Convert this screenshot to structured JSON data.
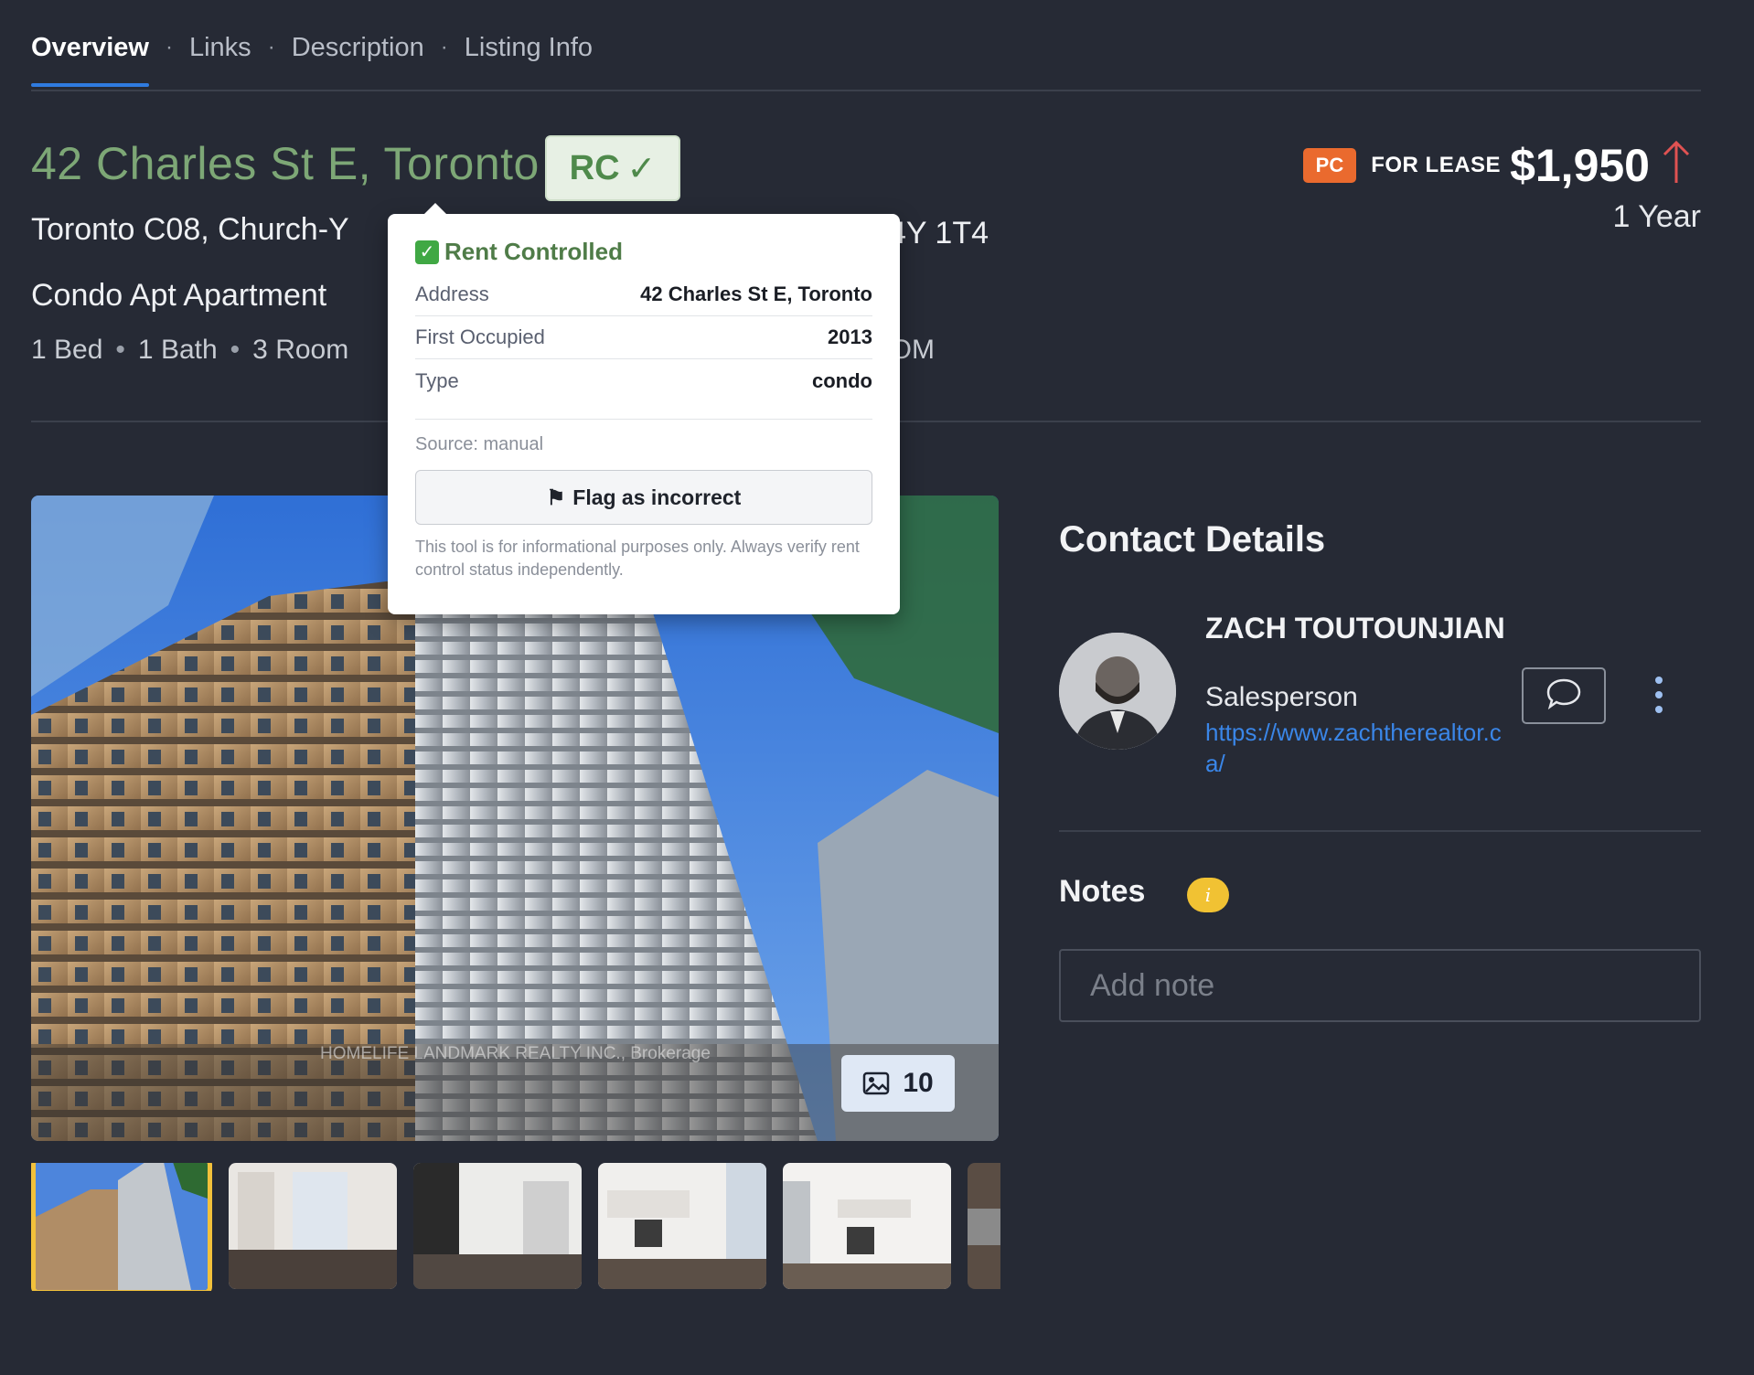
{
  "tabs": [
    {
      "label": "Overview",
      "active": true
    },
    {
      "label": "Links"
    },
    {
      "label": "Description"
    },
    {
      "label": "Listing Info"
    }
  ],
  "tab_separator": "·",
  "listing": {
    "address": "42 Charles St E, Toronto",
    "rc_badge": "RC",
    "area_line": "Toronto C08, Church-Y",
    "postal_tail": "4Y 1T4",
    "type_line": "Condo Apt Apartment",
    "beds": "1 Bed",
    "baths": "1 Bath",
    "rooms": "3 Room",
    "dom": "DOM",
    "pc_badge": "PC",
    "lease_label": "FOR LEASE",
    "price": "$1,950",
    "term": "1 Year"
  },
  "popover": {
    "title": "Rent Controlled",
    "rows": [
      {
        "key": "Address",
        "value": "42 Charles St E, Toronto"
      },
      {
        "key": "First Occupied",
        "value": "2013"
      },
      {
        "key": "Type",
        "value": "condo"
      }
    ],
    "source": "Source: manual",
    "flag_button": "Flag as incorrect",
    "disclaimer": "This tool is for informational purposes only. Always verify rent control status independently."
  },
  "gallery": {
    "watermark": "HOMELIFE LANDMARK REALTY INC., Brokerage",
    "photo_count": "10"
  },
  "contact": {
    "title": "Contact Details",
    "agent_name": "ZACH TOUTOUNJIAN",
    "agent_role": "Salesperson",
    "agent_link": "https://www.zachtherealtor.ca/"
  },
  "notes": {
    "title": "Notes",
    "info_icon": "i",
    "placeholder": "Add note"
  },
  "colors": {
    "background": "#262a35",
    "address_green": "#7da776",
    "pc_orange": "#ea6a2e",
    "link_blue": "#3a86e8",
    "highlight_yellow": "#f2c13b",
    "price_arrow_red": "#e05252"
  }
}
